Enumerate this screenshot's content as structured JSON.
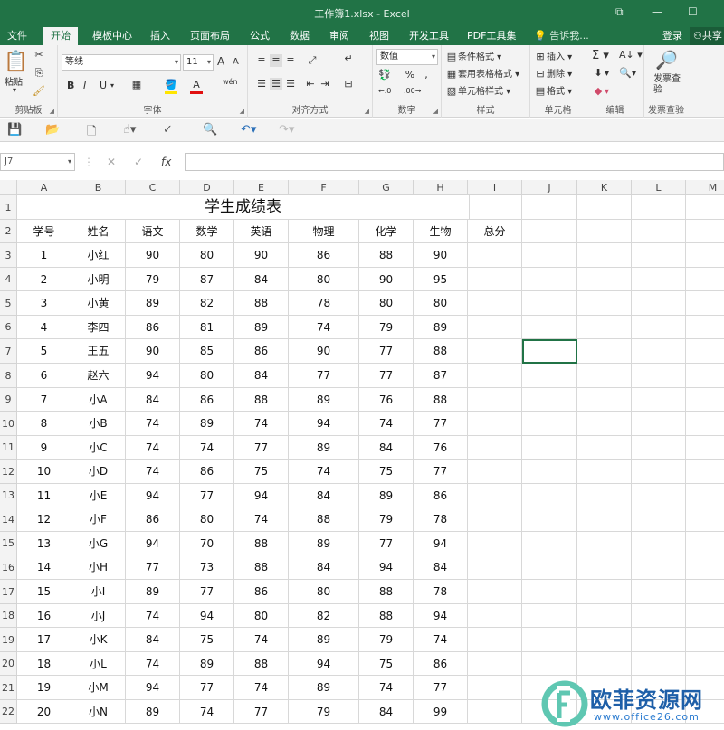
{
  "window": {
    "title": "工作簿1.xlsx - Excel",
    "restore": "⧉",
    "minimize": "—",
    "maximize": "☐"
  },
  "tabs": [
    "文件",
    "开始",
    "模板中心",
    "插入",
    "页面布局",
    "公式",
    "数据",
    "审阅",
    "视图",
    "开发工具",
    "PDF工具集"
  ],
  "tell_me": "告诉我...",
  "login": "登录",
  "share": "共享",
  "ribbon": {
    "clipboard": {
      "paste": "粘贴",
      "label": "剪贴板"
    },
    "font": {
      "name": "等线",
      "size": "11",
      "bold": "B",
      "italic": "I",
      "underline": "U",
      "grow": "A",
      "shrink": "A",
      "phonetic": "wén",
      "label": "字体"
    },
    "align": {
      "label": "对齐方式"
    },
    "number": {
      "format": "数值",
      "label": "数字"
    },
    "styles": {
      "cond": "条件格式",
      "table": "套用表格格式",
      "cell": "单元格样式",
      "label": "样式"
    },
    "cells": {
      "insert": "插入",
      "delete": "删除",
      "format": "格式",
      "label": "单元格"
    },
    "editing": {
      "label": "编辑"
    },
    "check": {
      "button": "发票查验",
      "label": "发票查验"
    }
  },
  "namebox": "J7",
  "fx": "fx",
  "columns": [
    "A",
    "B",
    "C",
    "D",
    "E",
    "F",
    "G",
    "H",
    "I",
    "J",
    "K",
    "L",
    "M"
  ],
  "rows": [
    "1",
    "2",
    "3",
    "4",
    "5",
    "6",
    "7",
    "8",
    "9",
    "10",
    "11",
    "12",
    "13",
    "14",
    "15",
    "16",
    "17",
    "18",
    "19",
    "20",
    "21",
    "22"
  ],
  "sheet": {
    "title": "学生成绩表",
    "headers": [
      "学号",
      "姓名",
      "语文",
      "数学",
      "英语",
      "物理",
      "化学",
      "生物",
      "总分"
    ],
    "data": [
      [
        "1",
        "小红",
        "90",
        "80",
        "90",
        "86",
        "88",
        "90"
      ],
      [
        "2",
        "小明",
        "79",
        "87",
        "84",
        "80",
        "90",
        "95"
      ],
      [
        "3",
        "小黄",
        "89",
        "82",
        "88",
        "78",
        "80",
        "80"
      ],
      [
        "4",
        "李四",
        "86",
        "81",
        "89",
        "74",
        "79",
        "89"
      ],
      [
        "5",
        "王五",
        "90",
        "85",
        "86",
        "90",
        "77",
        "88"
      ],
      [
        "6",
        "赵六",
        "94",
        "80",
        "84",
        "77",
        "77",
        "87"
      ],
      [
        "7",
        "小A",
        "84",
        "86",
        "88",
        "89",
        "76",
        "88"
      ],
      [
        "8",
        "小B",
        "74",
        "89",
        "74",
        "94",
        "74",
        "77"
      ],
      [
        "9",
        "小C",
        "74",
        "74",
        "77",
        "89",
        "84",
        "76"
      ],
      [
        "10",
        "小D",
        "74",
        "86",
        "75",
        "74",
        "75",
        "77"
      ],
      [
        "11",
        "小E",
        "94",
        "77",
        "94",
        "84",
        "89",
        "86"
      ],
      [
        "12",
        "小F",
        "86",
        "80",
        "74",
        "88",
        "79",
        "78"
      ],
      [
        "13",
        "小G",
        "94",
        "70",
        "88",
        "89",
        "77",
        "94"
      ],
      [
        "14",
        "小H",
        "77",
        "73",
        "88",
        "84",
        "94",
        "84"
      ],
      [
        "15",
        "小I",
        "89",
        "77",
        "86",
        "80",
        "88",
        "78"
      ],
      [
        "16",
        "小J",
        "74",
        "94",
        "80",
        "82",
        "88",
        "94"
      ],
      [
        "17",
        "小K",
        "84",
        "75",
        "74",
        "89",
        "79",
        "74"
      ],
      [
        "18",
        "小L",
        "74",
        "89",
        "88",
        "94",
        "75",
        "86"
      ],
      [
        "19",
        "小M",
        "94",
        "77",
        "74",
        "89",
        "74",
        "77"
      ],
      [
        "20",
        "小N",
        "89",
        "74",
        "77",
        "79",
        "84",
        "99"
      ]
    ]
  },
  "watermark": {
    "text": "欧菲资源网",
    "url": "www.office26.com"
  }
}
